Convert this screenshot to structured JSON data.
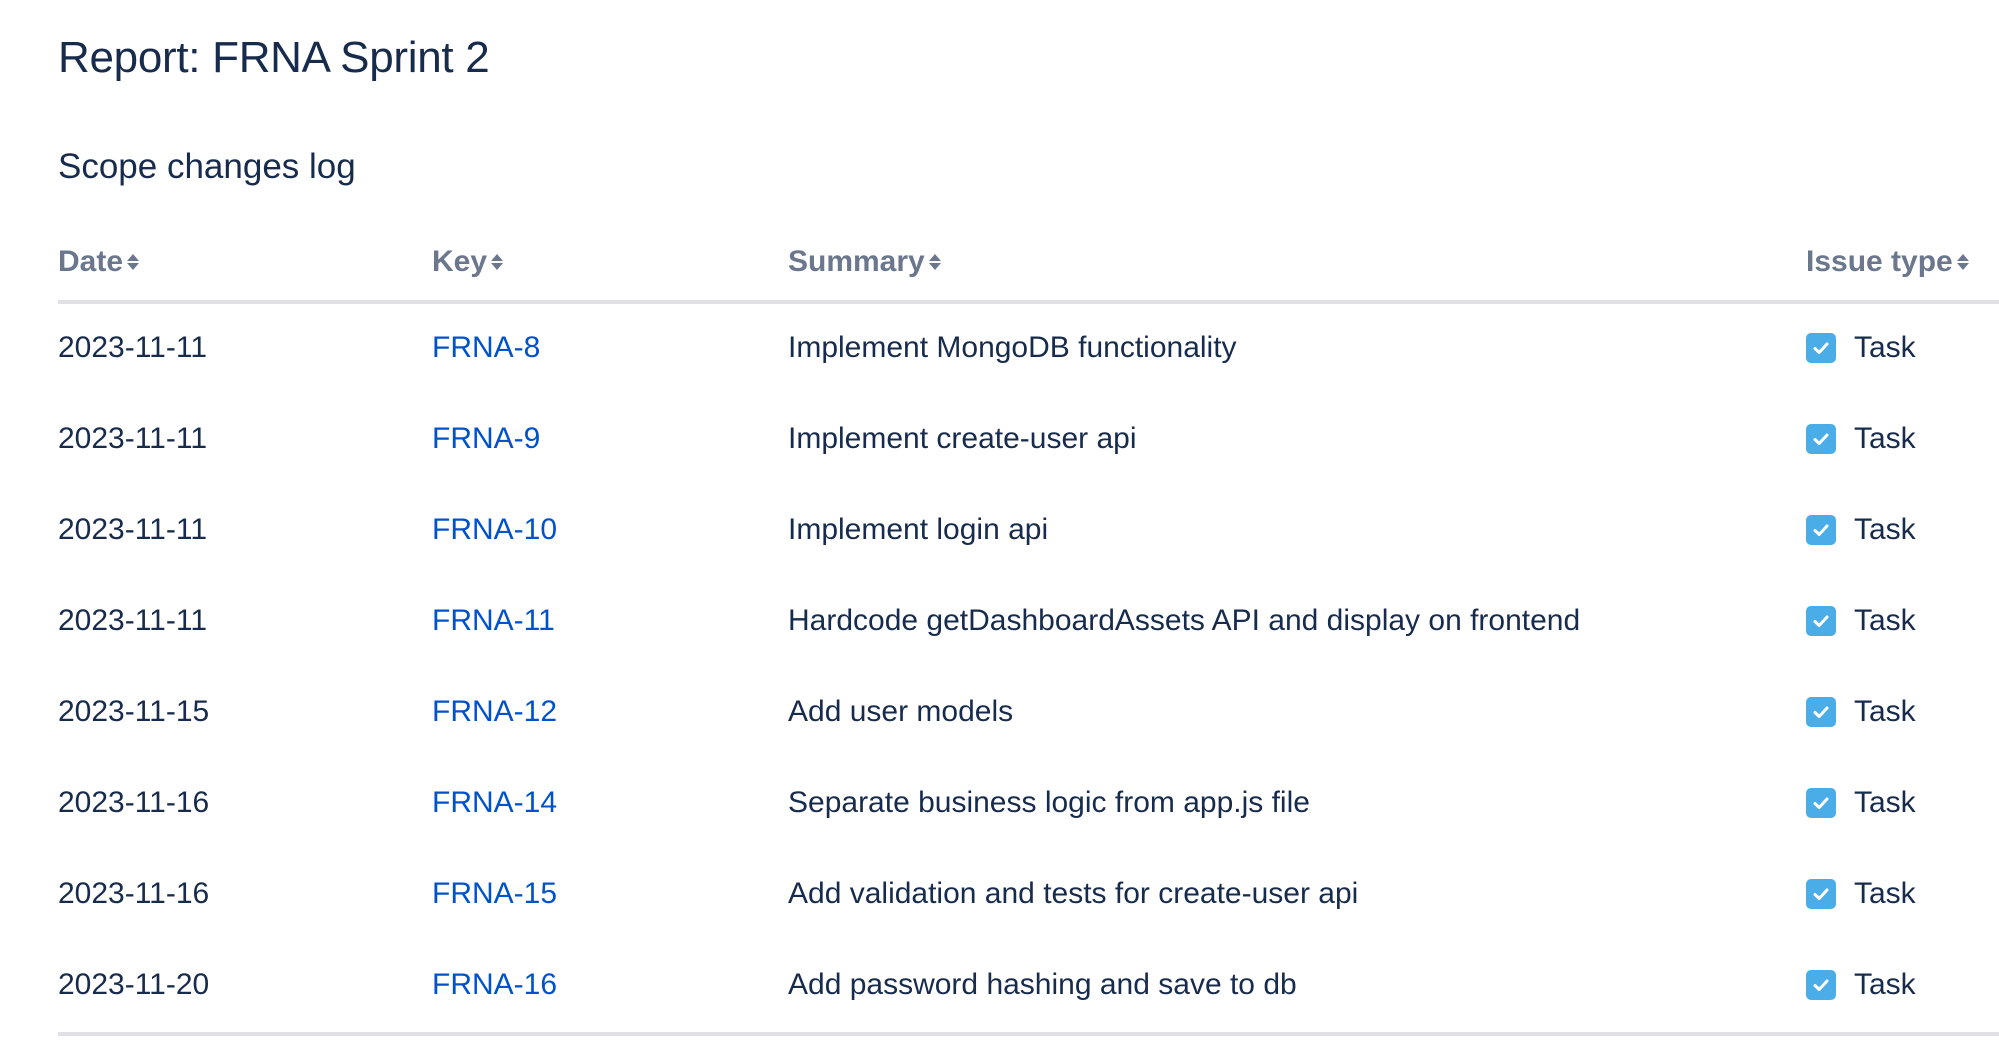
{
  "page": {
    "title": "Report: FRNA Sprint 2",
    "section_title": "Scope changes log"
  },
  "table": {
    "columns": [
      {
        "label": "Date",
        "sortable": true
      },
      {
        "label": "Key",
        "sortable": true
      },
      {
        "label": "Summary",
        "sortable": true
      },
      {
        "label": "Issue type",
        "sortable": true
      }
    ],
    "rows": [
      {
        "date": "2023-11-11",
        "key": "FRNA-8",
        "summary": "Implement MongoDB functionality",
        "issue_type": "Task",
        "icon": "task-checkbox-icon"
      },
      {
        "date": "2023-11-11",
        "key": "FRNA-9",
        "summary": "Implement create-user api",
        "issue_type": "Task",
        "icon": "task-checkbox-icon"
      },
      {
        "date": "2023-11-11",
        "key": "FRNA-10",
        "summary": "Implement login api",
        "issue_type": "Task",
        "icon": "task-checkbox-icon"
      },
      {
        "date": "2023-11-11",
        "key": "FRNA-11",
        "summary": "Hardcode getDashboardAssets API and display on frontend",
        "issue_type": "Task",
        "icon": "task-checkbox-icon"
      },
      {
        "date": "2023-11-15",
        "key": "FRNA-12",
        "summary": "Add user models",
        "issue_type": "Task",
        "icon": "task-checkbox-icon"
      },
      {
        "date": "2023-11-16",
        "key": "FRNA-14",
        "summary": "Separate business logic from app.js file",
        "issue_type": "Task",
        "icon": "task-checkbox-icon"
      },
      {
        "date": "2023-11-16",
        "key": "FRNA-15",
        "summary": "Add validation and tests for create-user api",
        "issue_type": "Task",
        "icon": "task-checkbox-icon"
      },
      {
        "date": "2023-11-20",
        "key": "FRNA-16",
        "summary": "Add password hashing and save to db",
        "issue_type": "Task",
        "icon": "task-checkbox-icon"
      }
    ]
  },
  "colors": {
    "text": "#172b4d",
    "header_text": "#6b778c",
    "link": "#0052cc",
    "task_icon": "#4bade8",
    "divider": "#dfe1e6"
  }
}
